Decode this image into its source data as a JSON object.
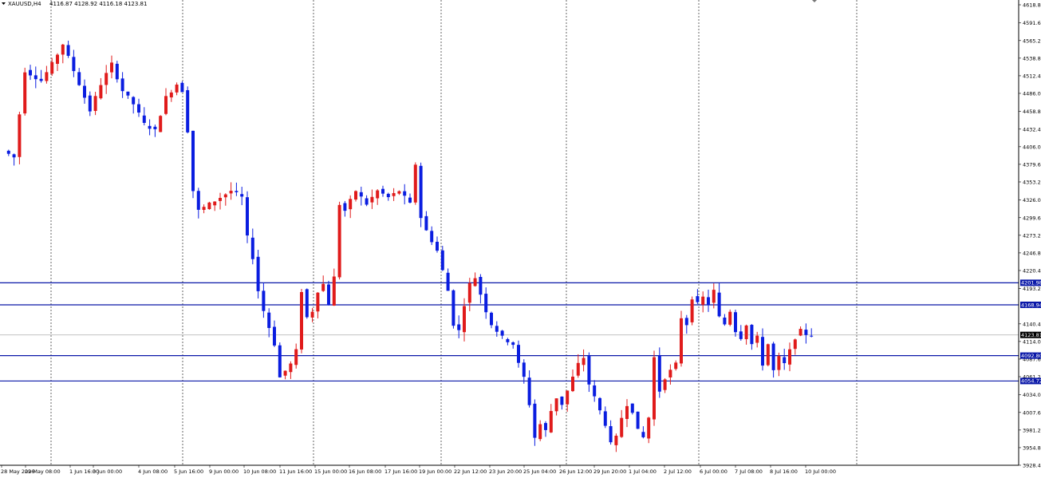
{
  "header": {
    "symbol": "XAUUSD,H4",
    "ohlc": "4116.87 4128.92 4116.18 4123.81"
  },
  "colors": {
    "bull": "#e01b1b",
    "bear": "#0a1de0",
    "level_line": "#0a18a8",
    "grid": "#000000",
    "price_line": "#b8b8b8",
    "background": "#ffffff"
  },
  "chart_data": {
    "type": "candlestick",
    "ylim": [
      3928.4,
      4620
    ],
    "y_ticks": [
      "4618.80",
      "4591.60",
      "4565.20",
      "4538.80",
      "4512.40",
      "4486.00",
      "4458.80",
      "4432.40",
      "4406.00",
      "4379.60",
      "4353.20",
      "4326.00",
      "4299.60",
      "4273.20",
      "4246.80",
      "4220.40",
      "4193.20",
      "4140.40",
      "4114.00",
      "4087.60",
      "4061.20",
      "4034.00",
      "4007.60",
      "3981.20",
      "3954.80",
      "3928.40"
    ],
    "x_labels": [
      "28 May 2026",
      "29 May 08:00",
      "1 Jun 16:00",
      "3 Jun 00:00",
      "4 Jun 08:00",
      "5 Jun 16:00",
      "9 Jun 00:00",
      "10 Jun 08:00",
      "11 Jun 16:00",
      "15 Jun 00:00",
      "16 Jun 08:00",
      "17 Jun 16:00",
      "19 Jun 00:00",
      "22 Jun 12:00",
      "23 Jun 20:00",
      "25 Jun 04:00",
      "26 Jun 12:00",
      "29 Jun 20:00",
      "1 Jul 04:00",
      "2 Jul 12:00",
      "6 Jul 00:00",
      "7 Jul 08:00",
      "8 Jul 16:00",
      "10 Jul 00:00"
    ],
    "levels": [
      {
        "value": 4201.98,
        "label": "4201.98"
      },
      {
        "value": 4168.94,
        "label": "4168.94"
      },
      {
        "value": 4092.8,
        "label": "4092.80"
      },
      {
        "value": 4054.72,
        "label": "4054.72"
      }
    ],
    "current_price": {
      "value": 4123.81,
      "label": "4123.81"
    },
    "anchors": [
      [
        0,
        4400
      ],
      [
        2,
        4390
      ],
      [
        4,
        4520
      ],
      [
        7,
        4505
      ],
      [
        9,
        4530
      ],
      [
        11,
        4560
      ],
      [
        12,
        4540
      ],
      [
        15,
        4480
      ],
      [
        16,
        4460
      ],
      [
        18,
        4500
      ],
      [
        20,
        4530
      ],
      [
        22,
        4490
      ],
      [
        24,
        4470
      ],
      [
        26,
        4440
      ],
      [
        28,
        4430
      ],
      [
        30,
        4480
      ],
      [
        32,
        4500
      ],
      [
        33,
        4490
      ],
      [
        34,
        4430
      ],
      [
        35,
        4340
      ],
      [
        36,
        4310
      ],
      [
        38,
        4320
      ],
      [
        40,
        4330
      ],
      [
        42,
        4340
      ],
      [
        44,
        4330
      ],
      [
        45,
        4270
      ],
      [
        46,
        4240
      ],
      [
        47,
        4190
      ],
      [
        48,
        4160
      ],
      [
        50,
        4110
      ],
      [
        51,
        4060
      ],
      [
        53,
        4080
      ],
      [
        54,
        4100
      ],
      [
        55,
        4190
      ],
      [
        56,
        4150
      ],
      [
        57,
        4160
      ],
      [
        58,
        4190
      ],
      [
        59,
        4200
      ],
      [
        60,
        4170
      ],
      [
        61,
        4210
      ],
      [
        62,
        4320
      ],
      [
        63,
        4310
      ],
      [
        65,
        4340
      ],
      [
        67,
        4320
      ],
      [
        69,
        4340
      ],
      [
        71,
        4330
      ],
      [
        73,
        4340
      ],
      [
        75,
        4320
      ],
      [
        76,
        4380
      ],
      [
        77,
        4300
      ],
      [
        78,
        4280
      ],
      [
        80,
        4250
      ],
      [
        81,
        4220
      ],
      [
        82,
        4190
      ],
      [
        83,
        4140
      ],
      [
        84,
        4130
      ],
      [
        85,
        4170
      ],
      [
        86,
        4200
      ],
      [
        87,
        4210
      ],
      [
        89,
        4160
      ],
      [
        90,
        4140
      ],
      [
        92,
        4120
      ],
      [
        94,
        4110
      ],
      [
        95,
        4080
      ],
      [
        96,
        4060
      ],
      [
        97,
        4020
      ],
      [
        98,
        3970
      ],
      [
        99,
        3990
      ],
      [
        100,
        3980
      ],
      [
        101,
        4010
      ],
      [
        102,
        4030
      ],
      [
        103,
        4020
      ],
      [
        104,
        4040
      ],
      [
        105,
        4060
      ],
      [
        106,
        4080
      ],
      [
        107,
        4090
      ],
      [
        108,
        4050
      ],
      [
        109,
        4030
      ],
      [
        110,
        4010
      ],
      [
        111,
        3990
      ],
      [
        112,
        3960
      ],
      [
        113,
        3970
      ],
      [
        114,
        4000
      ],
      [
        115,
        4020
      ],
      [
        116,
        4010
      ],
      [
        117,
        3980
      ],
      [
        118,
        3970
      ],
      [
        119,
        4000
      ],
      [
        120,
        4090
      ],
      [
        121,
        4040
      ],
      [
        122,
        4060
      ],
      [
        123,
        4070
      ],
      [
        124,
        4080
      ],
      [
        125,
        4150
      ],
      [
        126,
        4140
      ],
      [
        127,
        4180
      ],
      [
        128,
        4170
      ],
      [
        129,
        4180
      ],
      [
        130,
        4170
      ],
      [
        131,
        4190
      ],
      [
        132,
        4150
      ],
      [
        133,
        4140
      ],
      [
        134,
        4160
      ],
      [
        135,
        4130
      ],
      [
        136,
        4120
      ],
      [
        137,
        4140
      ],
      [
        138,
        4110
      ],
      [
        139,
        4120
      ],
      [
        140,
        4080
      ],
      [
        141,
        4110
      ],
      [
        142,
        4070
      ],
      [
        143,
        4090
      ],
      [
        144,
        4080
      ],
      [
        145,
        4100
      ],
      [
        146,
        4120
      ],
      [
        147,
        4130
      ],
      [
        148,
        4125
      ],
      [
        149,
        4123.81
      ]
    ]
  }
}
